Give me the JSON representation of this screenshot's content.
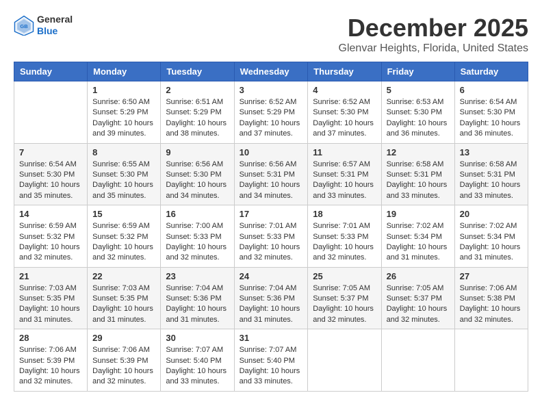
{
  "logo": {
    "general": "General",
    "blue": "Blue"
  },
  "title": {
    "month": "December 2025",
    "location": "Glenvar Heights, Florida, United States"
  },
  "headers": [
    "Sunday",
    "Monday",
    "Tuesday",
    "Wednesday",
    "Thursday",
    "Friday",
    "Saturday"
  ],
  "weeks": [
    [
      {
        "day": "",
        "info": ""
      },
      {
        "day": "1",
        "info": "Sunrise: 6:50 AM\nSunset: 5:29 PM\nDaylight: 10 hours\nand 39 minutes."
      },
      {
        "day": "2",
        "info": "Sunrise: 6:51 AM\nSunset: 5:29 PM\nDaylight: 10 hours\nand 38 minutes."
      },
      {
        "day": "3",
        "info": "Sunrise: 6:52 AM\nSunset: 5:29 PM\nDaylight: 10 hours\nand 37 minutes."
      },
      {
        "day": "4",
        "info": "Sunrise: 6:52 AM\nSunset: 5:30 PM\nDaylight: 10 hours\nand 37 minutes."
      },
      {
        "day": "5",
        "info": "Sunrise: 6:53 AM\nSunset: 5:30 PM\nDaylight: 10 hours\nand 36 minutes."
      },
      {
        "day": "6",
        "info": "Sunrise: 6:54 AM\nSunset: 5:30 PM\nDaylight: 10 hours\nand 36 minutes."
      }
    ],
    [
      {
        "day": "7",
        "info": "Sunrise: 6:54 AM\nSunset: 5:30 PM\nDaylight: 10 hours\nand 35 minutes."
      },
      {
        "day": "8",
        "info": "Sunrise: 6:55 AM\nSunset: 5:30 PM\nDaylight: 10 hours\nand 35 minutes."
      },
      {
        "day": "9",
        "info": "Sunrise: 6:56 AM\nSunset: 5:30 PM\nDaylight: 10 hours\nand 34 minutes."
      },
      {
        "day": "10",
        "info": "Sunrise: 6:56 AM\nSunset: 5:31 PM\nDaylight: 10 hours\nand 34 minutes."
      },
      {
        "day": "11",
        "info": "Sunrise: 6:57 AM\nSunset: 5:31 PM\nDaylight: 10 hours\nand 33 minutes."
      },
      {
        "day": "12",
        "info": "Sunrise: 6:58 AM\nSunset: 5:31 PM\nDaylight: 10 hours\nand 33 minutes."
      },
      {
        "day": "13",
        "info": "Sunrise: 6:58 AM\nSunset: 5:31 PM\nDaylight: 10 hours\nand 33 minutes."
      }
    ],
    [
      {
        "day": "14",
        "info": "Sunrise: 6:59 AM\nSunset: 5:32 PM\nDaylight: 10 hours\nand 32 minutes."
      },
      {
        "day": "15",
        "info": "Sunrise: 6:59 AM\nSunset: 5:32 PM\nDaylight: 10 hours\nand 32 minutes."
      },
      {
        "day": "16",
        "info": "Sunrise: 7:00 AM\nSunset: 5:33 PM\nDaylight: 10 hours\nand 32 minutes."
      },
      {
        "day": "17",
        "info": "Sunrise: 7:01 AM\nSunset: 5:33 PM\nDaylight: 10 hours\nand 32 minutes."
      },
      {
        "day": "18",
        "info": "Sunrise: 7:01 AM\nSunset: 5:33 PM\nDaylight: 10 hours\nand 32 minutes."
      },
      {
        "day": "19",
        "info": "Sunrise: 7:02 AM\nSunset: 5:34 PM\nDaylight: 10 hours\nand 31 minutes."
      },
      {
        "day": "20",
        "info": "Sunrise: 7:02 AM\nSunset: 5:34 PM\nDaylight: 10 hours\nand 31 minutes."
      }
    ],
    [
      {
        "day": "21",
        "info": "Sunrise: 7:03 AM\nSunset: 5:35 PM\nDaylight: 10 hours\nand 31 minutes."
      },
      {
        "day": "22",
        "info": "Sunrise: 7:03 AM\nSunset: 5:35 PM\nDaylight: 10 hours\nand 31 minutes."
      },
      {
        "day": "23",
        "info": "Sunrise: 7:04 AM\nSunset: 5:36 PM\nDaylight: 10 hours\nand 31 minutes."
      },
      {
        "day": "24",
        "info": "Sunrise: 7:04 AM\nSunset: 5:36 PM\nDaylight: 10 hours\nand 31 minutes."
      },
      {
        "day": "25",
        "info": "Sunrise: 7:05 AM\nSunset: 5:37 PM\nDaylight: 10 hours\nand 32 minutes."
      },
      {
        "day": "26",
        "info": "Sunrise: 7:05 AM\nSunset: 5:37 PM\nDaylight: 10 hours\nand 32 minutes."
      },
      {
        "day": "27",
        "info": "Sunrise: 7:06 AM\nSunset: 5:38 PM\nDaylight: 10 hours\nand 32 minutes."
      }
    ],
    [
      {
        "day": "28",
        "info": "Sunrise: 7:06 AM\nSunset: 5:39 PM\nDaylight: 10 hours\nand 32 minutes."
      },
      {
        "day": "29",
        "info": "Sunrise: 7:06 AM\nSunset: 5:39 PM\nDaylight: 10 hours\nand 32 minutes."
      },
      {
        "day": "30",
        "info": "Sunrise: 7:07 AM\nSunset: 5:40 PM\nDaylight: 10 hours\nand 33 minutes."
      },
      {
        "day": "31",
        "info": "Sunrise: 7:07 AM\nSunset: 5:40 PM\nDaylight: 10 hours\nand 33 minutes."
      },
      {
        "day": "",
        "info": ""
      },
      {
        "day": "",
        "info": ""
      },
      {
        "day": "",
        "info": ""
      }
    ]
  ]
}
